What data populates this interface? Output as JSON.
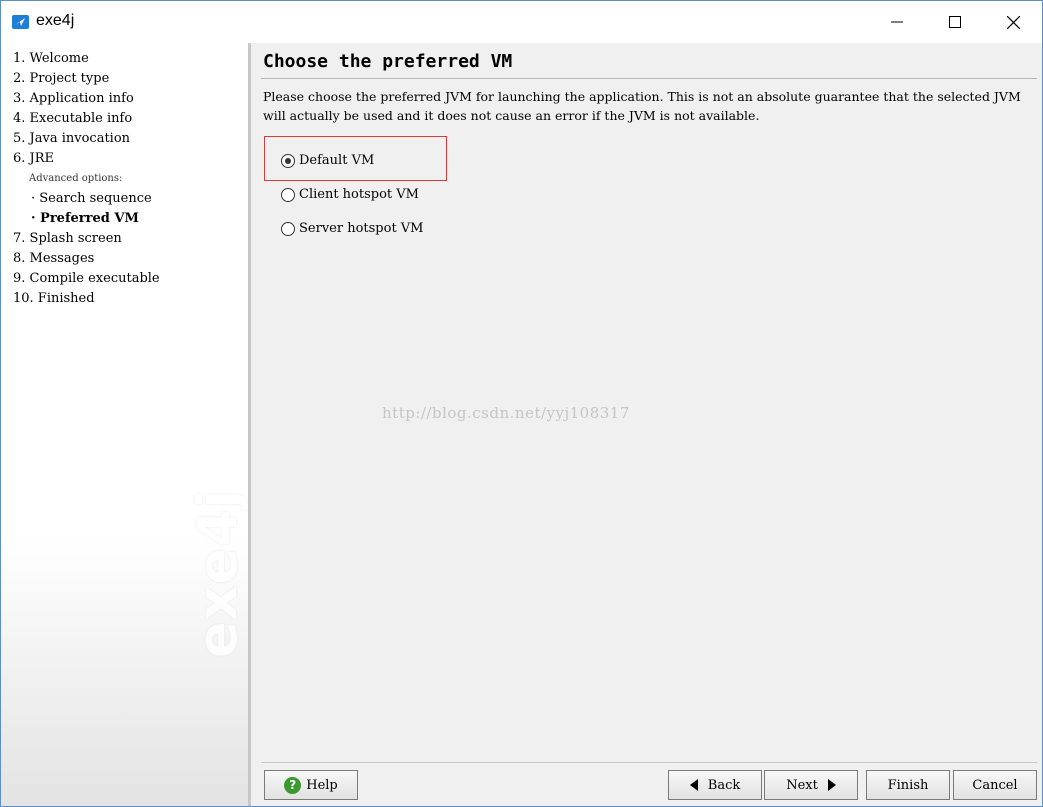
{
  "window": {
    "title": "exe4j",
    "accent_color": "#1e7fd8"
  },
  "sidebar": {
    "steps": [
      {
        "label": "1. Welcome"
      },
      {
        "label": "2. Project type"
      },
      {
        "label": "3. Application info"
      },
      {
        "label": "4. Executable info"
      },
      {
        "label": "5. Java invocation"
      },
      {
        "label": "6. JRE"
      }
    ],
    "advanced_label": "Advanced options:",
    "sub_steps": [
      {
        "label": "· Search sequence",
        "active": false
      },
      {
        "label": "· Preferred VM",
        "active": true
      }
    ],
    "steps_after": [
      {
        "label": "7. Splash screen"
      },
      {
        "label": "8. Messages"
      },
      {
        "label": "9. Compile executable"
      },
      {
        "label": "10. Finished"
      }
    ],
    "logo_text": "exe4j"
  },
  "main": {
    "title": "Choose the preferred VM",
    "description": "Please choose the preferred JVM for launching the application. This is not an absolute guarantee that the selected JVM will actually be used and it does not cause an error if the JVM is not available.",
    "options": [
      {
        "label": "Default VM",
        "checked": true
      },
      {
        "label": "Client hotspot VM",
        "checked": false
      },
      {
        "label": "Server hotspot VM",
        "checked": false
      }
    ],
    "watermark": "http://blog.csdn.net/yyj108317"
  },
  "buttons": {
    "help": "Help",
    "back": "Back",
    "next": "Next",
    "finish": "Finish",
    "cancel": "Cancel"
  }
}
